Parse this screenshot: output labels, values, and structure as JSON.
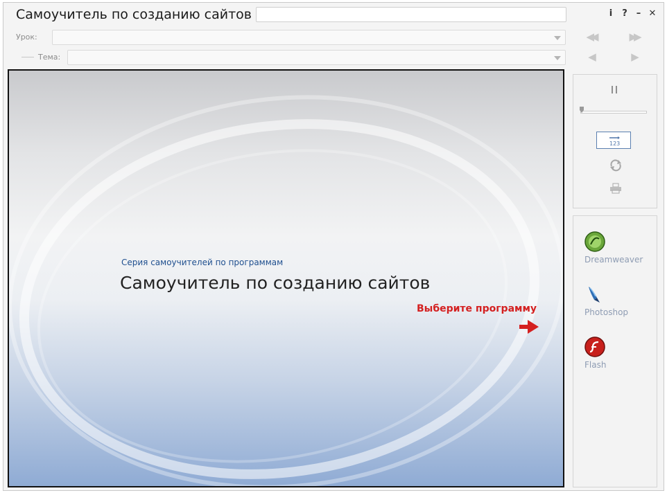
{
  "window": {
    "title": "Самоучитель по созданию сайтов",
    "buttons": {
      "info": "i",
      "help": "?",
      "minimize": "–",
      "close": "✕"
    }
  },
  "selectors": {
    "lesson_label": "Урок:",
    "topic_label": "Тема:",
    "lesson_value": "",
    "topic_value": ""
  },
  "viewer": {
    "series": "Серия самоучителей по программам",
    "title": "Самоучитель по созданию сайтов",
    "prompt": "Выберите программу"
  },
  "controls": {
    "pause": "pause",
    "subtitles_icon": "subtitles-icon",
    "repeat_icon": "repeat-icon",
    "print_icon": "print-icon",
    "playback_position": 0.0
  },
  "programs": [
    {
      "name": "Dreamweaver",
      "icon": "dreamweaver-icon",
      "color": "#6aa63a"
    },
    {
      "name": "Photoshop",
      "icon": "photoshop-icon",
      "color": "#2f6fb6"
    },
    {
      "name": "Flash",
      "icon": "flash-icon",
      "color": "#c8201c"
    }
  ],
  "colors": {
    "accent_red": "#d42020",
    "series_blue": "#1f4f8f",
    "program_label": "#8e9cb3"
  }
}
